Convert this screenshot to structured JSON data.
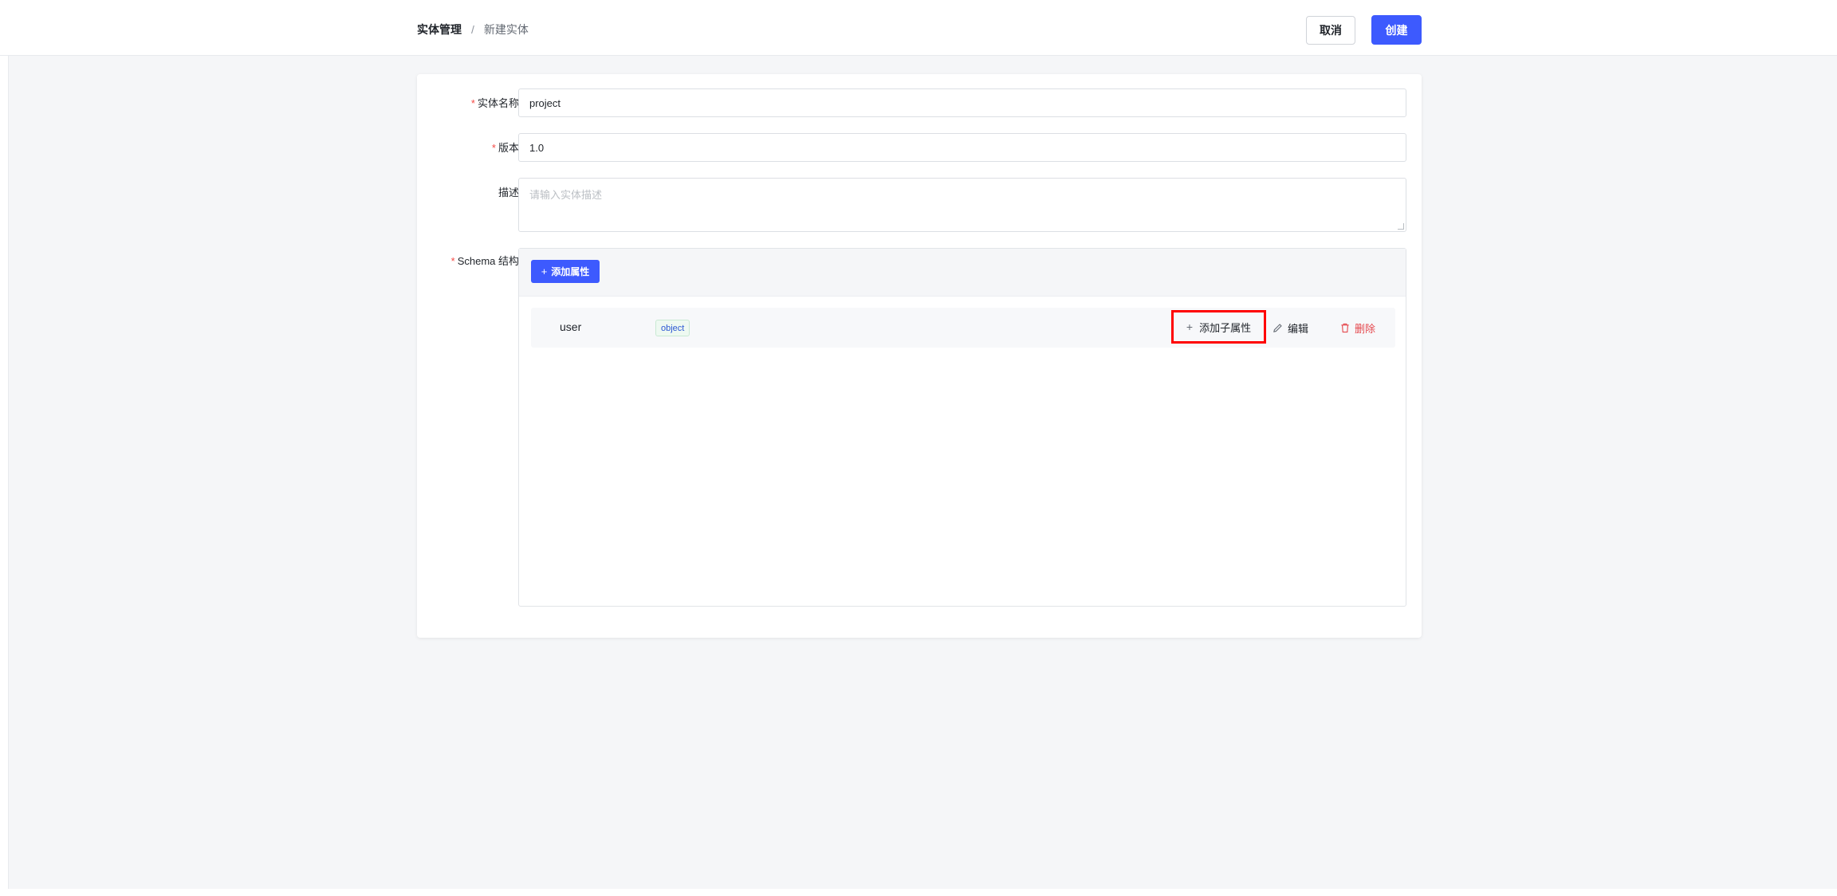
{
  "breadcrumb": {
    "root": "实体管理",
    "separator": "/",
    "current": "新建实体"
  },
  "header": {
    "cancel_label": "取消",
    "create_label": "创建"
  },
  "form": {
    "name_label": "实体名称",
    "name_value": "project",
    "version_label": "版本",
    "version_value": "1.0",
    "desc_label": "描述",
    "desc_placeholder": "请输入实体描述",
    "schema_label": "Schema 结构",
    "required_mark": "*"
  },
  "schema": {
    "add_property_label": "添加属性",
    "properties": [
      {
        "name": "user",
        "type": "object",
        "add_child_label": "添加子属性",
        "edit_label": "编辑",
        "delete_label": "删除"
      }
    ]
  },
  "colors": {
    "primary": "#3d5afe",
    "danger": "#e5484d",
    "highlight": "#ff0000",
    "background": "#f5f6f8"
  },
  "icons": [
    "plus-icon",
    "edit-icon",
    "trash-icon"
  ]
}
